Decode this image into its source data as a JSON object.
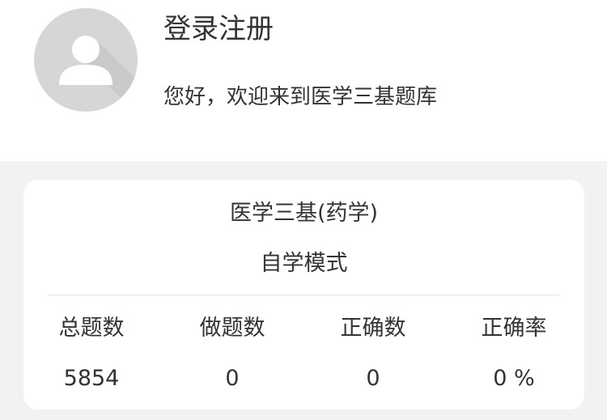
{
  "profile": {
    "avatar_icon": "user-avatar-icon",
    "login_label": "登录注册",
    "welcome": "您好，欢迎来到医学三基题库"
  },
  "card": {
    "title": "医学三基(药学)",
    "mode": "自学模式",
    "stats": [
      {
        "label": "总题数",
        "value": "5854"
      },
      {
        "label": "做题数",
        "value": "0"
      },
      {
        "label": "正确数",
        "value": "0"
      },
      {
        "label": "正确率",
        "value": "0 %"
      }
    ]
  },
  "colors": {
    "page_background": "#f2f2f2",
    "card_background": "#ffffff",
    "avatar_background": "#d6d6d6",
    "text": "#333333"
  }
}
